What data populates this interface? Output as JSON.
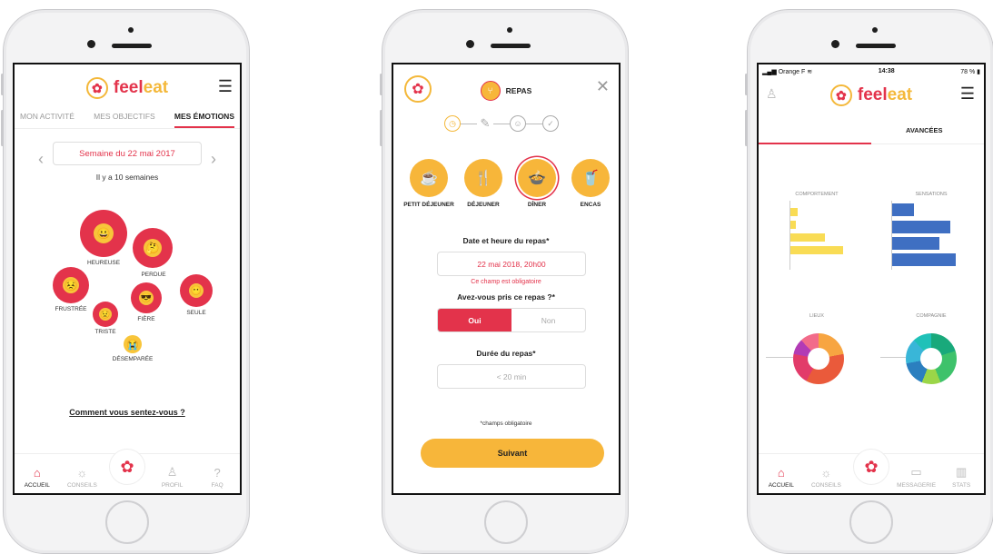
{
  "phone1": {
    "brand_left": "feel",
    "brand_right": "eat",
    "menu_icon": "hamburger-icon",
    "tabs": [
      "MON ACTIVITÉ",
      "MES OBJECTIFS",
      "MES ÉMOTIONS"
    ],
    "active_tab": "MES ÉMOTIONS",
    "week_label": "Semaine du 22 mai 2017",
    "weeks_ago": "Il y a 10 semaines",
    "emotions": [
      {
        "label": "HEUREUSE",
        "emoji": "😀"
      },
      {
        "label": "PERDUE",
        "emoji": "🤔"
      },
      {
        "label": "FRUSTRÉE",
        "emoji": "😣"
      },
      {
        "label": "FIÈRE",
        "emoji": "😎"
      },
      {
        "label": "SEULE",
        "emoji": "😶"
      },
      {
        "label": "TRISTE",
        "emoji": "😟"
      },
      {
        "label": "DÉSEMPARÉE",
        "emoji": "😭"
      }
    ],
    "question": "Comment vous sentez-vous ?",
    "nav": [
      "ACCUEIL",
      "CONSEILS",
      "PROFIL",
      "FAQ"
    ]
  },
  "phone2": {
    "header_title": "REPAS",
    "meals": [
      "PETIT DÉJEUNER",
      "DÉJEUNER",
      "DÎNER",
      "ENCAS"
    ],
    "selected_meal": "DÎNER",
    "date_label": "Date et heure du repas*",
    "date_value": "22 mai 2018, 20h00",
    "date_error": "Ce champ est obligatoire",
    "taken_label": "Avez-vous pris ce repas ?*",
    "yes": "Oui",
    "no": "Non",
    "duration_label": "Durée du repas*",
    "duration_value": "< 20 min",
    "required_note": "*champs obligatoire",
    "next_button": "Suivant"
  },
  "phone3": {
    "carrier": "Orange F",
    "time": "14:38",
    "battery": "78 %",
    "brand_left": "feel",
    "brand_right": "eat",
    "tab_advanced": "AVANCÉES",
    "charts": {
      "comportement": "COMPORTEMENT",
      "sensations": "SENSATIONS",
      "lieux": "LIEUX",
      "compagnie": "COMPAGNIE"
    },
    "nav": [
      "ACCUEIL",
      "CONSEILS",
      "MESSAGERIE",
      "STATS"
    ]
  },
  "colors": {
    "brand_red": "#e3334b",
    "brand_yellow": "#f7b63a",
    "chart_yellow": "#f9dc55",
    "chart_blue": "#3f6fc2"
  }
}
